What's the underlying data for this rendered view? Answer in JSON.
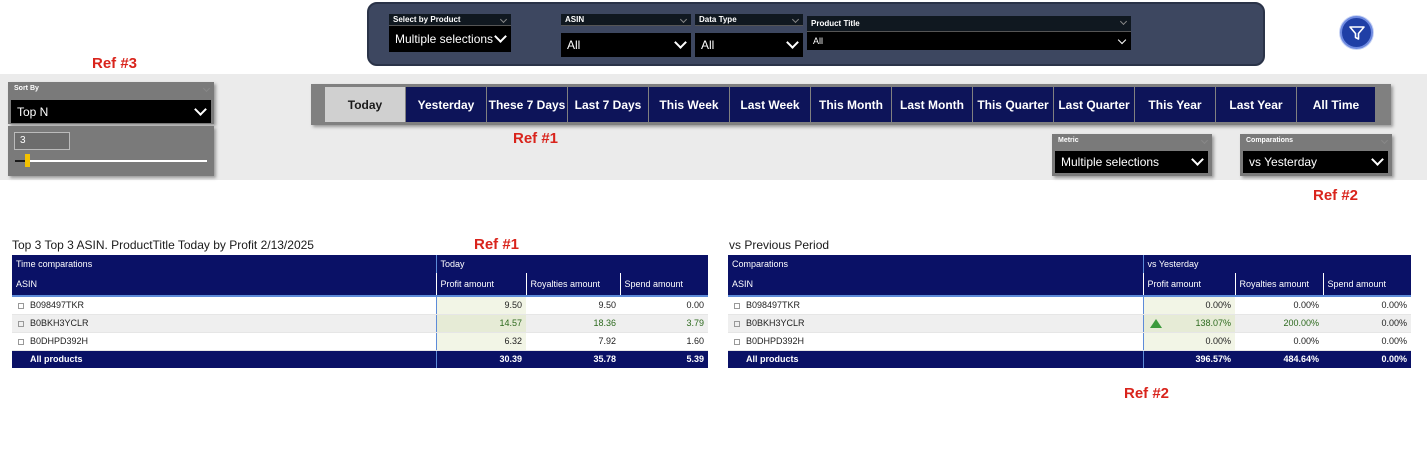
{
  "filters": {
    "select_by_product": {
      "label": "Select by Product",
      "value": "Multiple selections"
    },
    "asin": {
      "label": "ASIN",
      "value": "All"
    },
    "data_type": {
      "label": "Data Type",
      "value": "All"
    },
    "product_title": {
      "label": "Product Title",
      "value": "All"
    }
  },
  "refs": {
    "ref3": "Ref #3",
    "ref1": "Ref #1",
    "ref2": "Ref #2"
  },
  "sort_by": {
    "label": "Sort By",
    "value": "Top N"
  },
  "top_n": {
    "value": "3",
    "slider_fraction": 0.08
  },
  "period_tabs": [
    {
      "label": "Today",
      "active": true
    },
    {
      "label": "Yesterday"
    },
    {
      "label": "These 7 Days"
    },
    {
      "label": "Last 7 Days"
    },
    {
      "label": "This Week"
    },
    {
      "label": "Last Week"
    },
    {
      "label": "This Month"
    },
    {
      "label": "Last Month"
    },
    {
      "label": "This Quarter"
    },
    {
      "label": "Last Quarter"
    },
    {
      "label": "This Year"
    },
    {
      "label": "Last Year"
    },
    {
      "label": "All Time"
    }
  ],
  "metric": {
    "label": "Metric",
    "value": "Multiple selections"
  },
  "comparations": {
    "label": "Comparations",
    "value": "vs Yesterday"
  },
  "left_table": {
    "title": "Top 3 Top 3 ASIN. ProductTitle Today by Profit 2/13/2025",
    "group_header": {
      "first": "Time comparations",
      "second": "Today"
    },
    "columns": [
      "ASIN",
      "Profit amount",
      "Royalties amount",
      "Spend amount"
    ],
    "rows": [
      {
        "asin": "B098497TKR",
        "profit": "9.50",
        "royalties": "9.50",
        "spend": "0.00"
      },
      {
        "asin": "B0BKH3YCLR",
        "profit": "14.57",
        "royalties": "18.36",
        "spend": "3.79"
      },
      {
        "asin": "B0DHPD392H",
        "profit": "6.32",
        "royalties": "7.92",
        "spend": "1.60"
      }
    ],
    "total": {
      "label": "All products",
      "profit": "30.39",
      "royalties": "35.78",
      "spend": "5.39"
    }
  },
  "right_table": {
    "title": "vs Previous Period",
    "group_header": {
      "first": "Comparations",
      "second": "vs Yesterday"
    },
    "columns": [
      "ASIN",
      "Profit amount",
      "Royalties amount",
      "Spend amount"
    ],
    "rows": [
      {
        "asin": "B098497TKR",
        "profit": "0.00%",
        "royalties": "0.00%",
        "spend": "0.00%",
        "up": false
      },
      {
        "asin": "B0BKH3YCLR",
        "profit": "138.07%",
        "royalties": "200.00%",
        "spend": "0.00%",
        "up": true
      },
      {
        "asin": "B0DHPD392H",
        "profit": "0.00%",
        "royalties": "0.00%",
        "spend": "0.00%",
        "up": false
      }
    ],
    "total": {
      "label": "All products",
      "profit": "396.57%",
      "royalties": "484.64%",
      "spend": "0.00%"
    }
  },
  "colors": {
    "navy": "#0a1166",
    "active_tab": "#d0d0d0",
    "ref_red": "#d9241c",
    "up_green": "#3c9a3c"
  }
}
